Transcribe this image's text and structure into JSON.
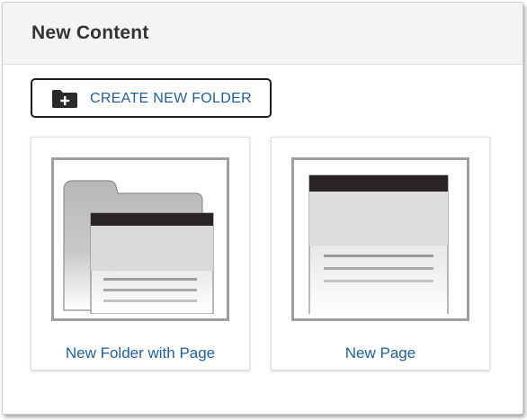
{
  "header": {
    "title": "New Content"
  },
  "toolbar": {
    "create_folder_label": "CREATE NEW FOLDER",
    "create_folder_icon": "folder-plus-icon"
  },
  "cards": [
    {
      "label": "New Folder with Page",
      "icon": "folder-with-page-icon"
    },
    {
      "label": "New Page",
      "icon": "page-icon"
    }
  ],
  "colors": {
    "link_blue": "#1f5f9e",
    "title_text": "#333333",
    "header_bg": "#f4f4f4",
    "button_border": "#1e1e1e",
    "thumbnail_bar": "#2a2324"
  }
}
